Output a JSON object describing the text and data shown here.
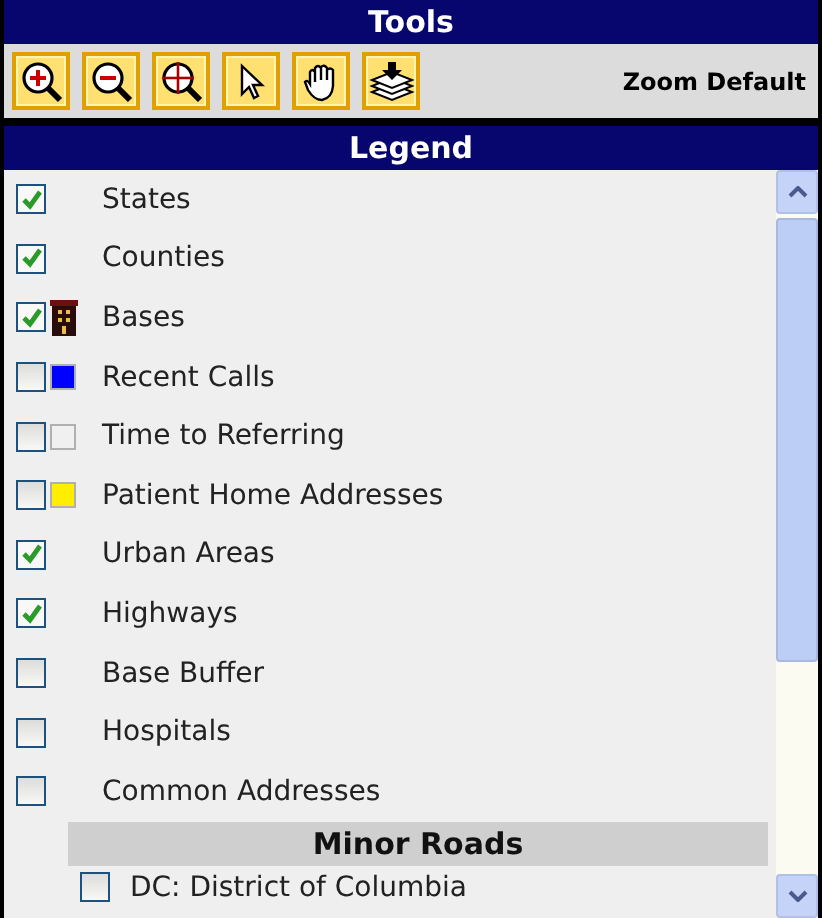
{
  "tools": {
    "title": "Tools",
    "buttons": [
      {
        "kind": "zoom-in"
      },
      {
        "kind": "zoom-out"
      },
      {
        "kind": "zoom-extent"
      },
      {
        "kind": "pointer"
      },
      {
        "kind": "pan"
      },
      {
        "kind": "layers"
      }
    ],
    "zoom_default": "Zoom Default"
  },
  "legend": {
    "title": "Legend",
    "items": [
      {
        "label": "States",
        "checked": true,
        "kind": "plain"
      },
      {
        "label": "Counties",
        "checked": true,
        "kind": "plain"
      },
      {
        "label": "Bases",
        "checked": true,
        "kind": "building"
      },
      {
        "label": "Recent Calls",
        "checked": false,
        "kind": "swatch",
        "color": "#0000ff"
      },
      {
        "label": "Time to Referring",
        "checked": false,
        "kind": "swatch",
        "color": "#f0f0f0"
      },
      {
        "label": "Patient Home Addresses",
        "checked": false,
        "kind": "swatch",
        "color": "#ffee00"
      },
      {
        "label": "Urban Areas",
        "checked": true,
        "kind": "plain"
      },
      {
        "label": "Highways",
        "checked": true,
        "kind": "plain"
      },
      {
        "label": "Base Buffer",
        "checked": false,
        "kind": "plain"
      },
      {
        "label": "Hospitals",
        "checked": false,
        "kind": "plain"
      },
      {
        "label": "Common Addresses",
        "checked": false,
        "kind": "plain"
      }
    ],
    "minor_roads": {
      "title": "Minor Roads",
      "items": [
        {
          "label": "DC: District of Columbia",
          "checked": false
        }
      ]
    }
  }
}
